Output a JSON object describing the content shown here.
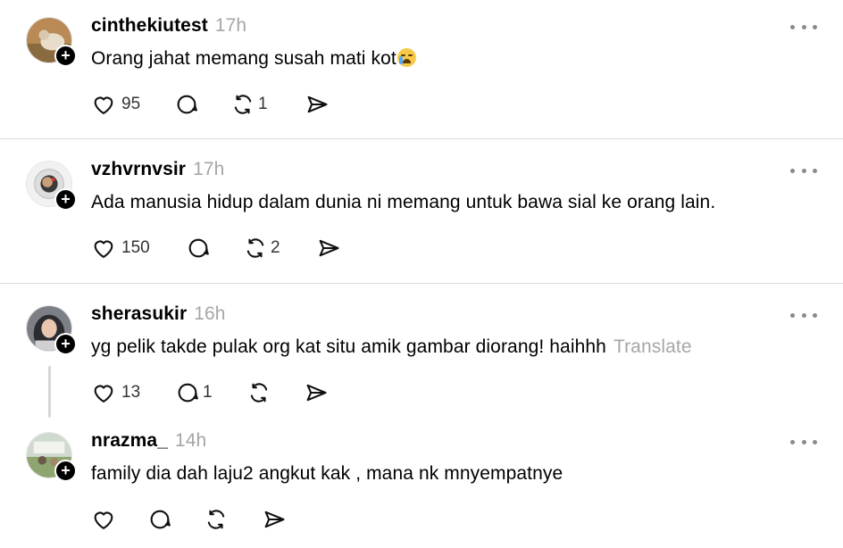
{
  "posts": [
    {
      "username": "cinthekiutest",
      "time": "17h",
      "text": "Orang jahat memang susah mati kot",
      "emoji": "loudly-crying-face",
      "likes": "95",
      "replies": "",
      "reposts": "1",
      "translate": ""
    },
    {
      "username": "vzhvrnvsir",
      "time": "17h",
      "text": "Ada manusia hidup dalam dunia ni memang untuk bawa sial ke orang lain.",
      "likes": "150",
      "replies": "",
      "reposts": "2",
      "translate": ""
    },
    {
      "username": "sherasukir",
      "time": "16h",
      "text": "yg pelik takde pulak org kat situ amik gambar diorang! haihhh",
      "likes": "13",
      "replies": "1",
      "reposts": "",
      "translate": "Translate"
    },
    {
      "username": "nrazma_",
      "time": "14h",
      "text": "family dia dah laju2 angkut kak , mana nk mnyempatnye",
      "likes": "",
      "replies": "",
      "reposts": "",
      "translate": ""
    }
  ],
  "icons": {
    "like": "heart-icon",
    "reply": "comment-icon",
    "repost": "repost-icon",
    "share": "send-icon",
    "more": "more-icon",
    "follow": "plus-icon"
  },
  "colors": {
    "text": "#000000",
    "muted": "#a6a6a6",
    "divider": "#dcdcdc",
    "badge": "#000000"
  }
}
